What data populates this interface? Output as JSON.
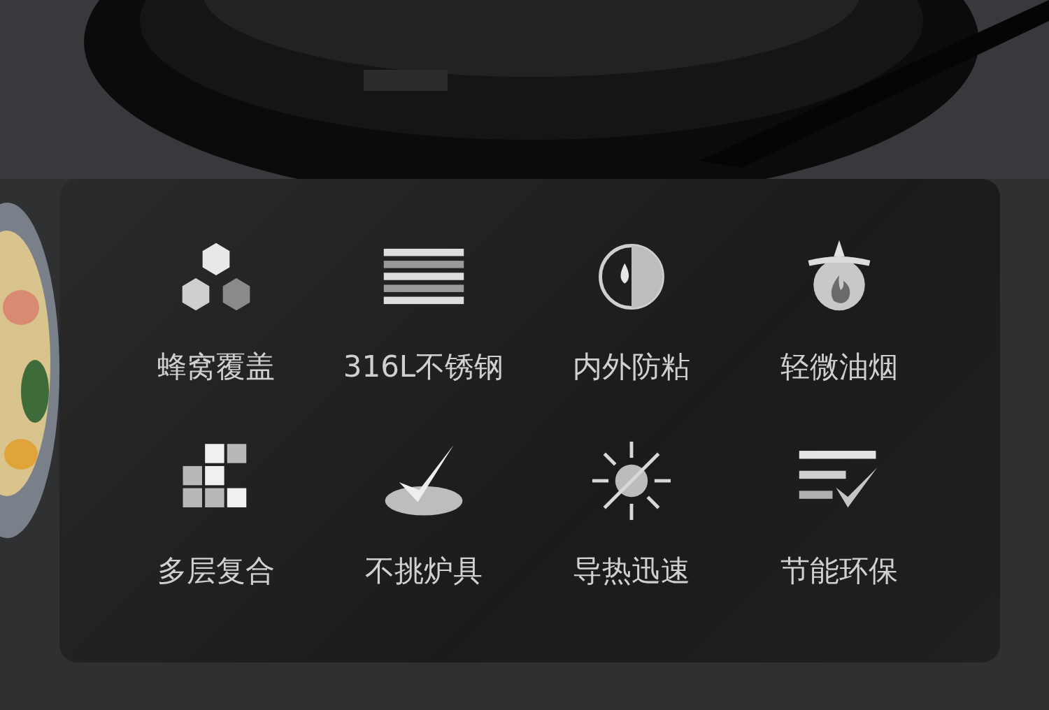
{
  "features": [
    {
      "kind": "hexagons",
      "label": "蜂窝覆盖"
    },
    {
      "kind": "stripes",
      "label": "316L不锈钢"
    },
    {
      "kind": "droplet",
      "label": "内外防粘"
    },
    {
      "kind": "flame",
      "label": "轻微油烟"
    },
    {
      "kind": "blocks",
      "label": "多层复合"
    },
    {
      "kind": "check",
      "label": "不挑炉具"
    },
    {
      "kind": "sun",
      "label": "导热迅速"
    },
    {
      "kind": "checklist",
      "label": "节能环保"
    }
  ]
}
